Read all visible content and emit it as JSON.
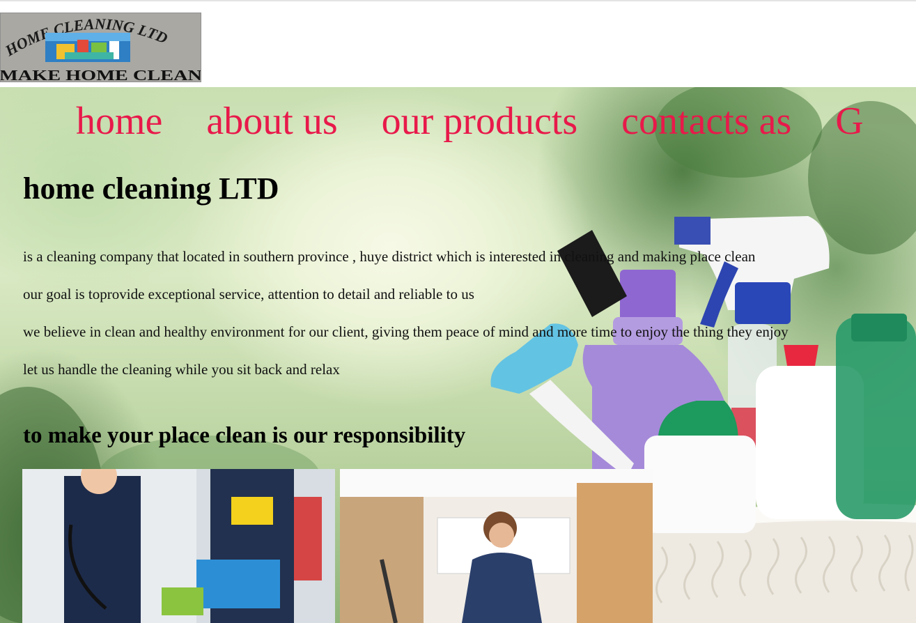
{
  "logo": {
    "top_text": "HOME CLEANING LTD",
    "bottom_text": "MAKE HOME CLEAN"
  },
  "nav": {
    "items": [
      "home",
      "about us",
      "our products",
      "contacts as",
      "G"
    ]
  },
  "hero": {
    "title": "home cleaning LTD",
    "paragraphs": [
      "is a cleaning company that located in southern province , huye district which is interested in cleaning and making place clean",
      "our goal is toprovide exceptional service, attention to detail and reliable to us",
      "we believe in clean and healthy environment for our client, giving them peace of mind and more time to enjoy the thing they enjoy",
      "let us handle the cleaning while you sit back and relax"
    ],
    "subtitle": "to make your place clean is our responsibility"
  },
  "colors": {
    "nav_link": "#e8194a",
    "text": "#000000"
  }
}
